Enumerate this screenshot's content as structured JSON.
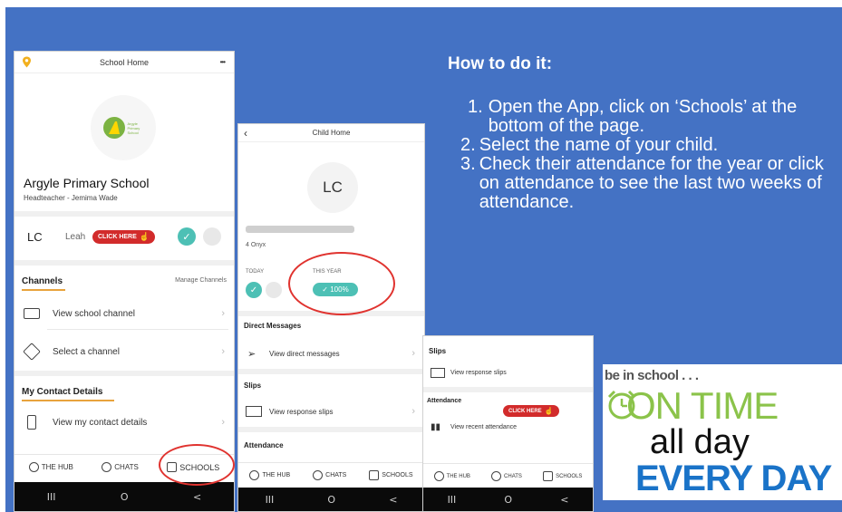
{
  "instructions": {
    "title": "How to do it:",
    "steps": [
      {
        "num": "1.",
        "text": "Open the App, click on ‘Schools’ at the bottom of the page."
      },
      {
        "num": "2.",
        "text": "Select the name of your child."
      },
      {
        "num": "3.",
        "text": "Check their attendance for the year or click on attendance to see the last two weeks of attendance."
      }
    ]
  },
  "phone1": {
    "header_title": "School Home",
    "more_label": "•••",
    "school_name": "Argyle Primary School",
    "headteacher": "Headteacher - Jemima Wade",
    "logo_text": "Argyle Primary School",
    "child_initials": "LC",
    "child_name_partial": "Leah",
    "click_here": "CLICK HERE",
    "channels_heading": "Channels",
    "manage_channels": "Manage Channels",
    "view_school_channel": "View school channel",
    "select_channel": "Select a channel",
    "contact_heading": "My Contact Details",
    "view_contact": "View my contact details",
    "tabs": {
      "hub": "THE HUB",
      "chats": "CHATS",
      "schools": "SCHOOLS"
    }
  },
  "phone2": {
    "back": "‹",
    "header_title": "Child Home",
    "initials": "LC",
    "class_label": "4 Onyx",
    "today_label": "TODAY",
    "this_year_label": "THIS YEAR",
    "this_year_value": "✓ 100%",
    "direct_messages_heading": "Direct Messages",
    "view_direct_messages": "View direct messages",
    "slips_heading": "Slips",
    "view_response_slips": "View response slips",
    "attendance_heading": "Attendance",
    "tabs": {
      "hub": "THE HUB",
      "chats": "CHATS",
      "schools": "SCHOOLS"
    }
  },
  "phone3": {
    "slips_heading": "Slips",
    "view_response_slips": "View response slips",
    "attendance_heading": "Attendance",
    "view_recent_attendance": "View recent attendance",
    "click_here": "CLICK HERE",
    "tabs": {
      "hub": "THE HUB",
      "chats": "CHATS",
      "schools": "SCHOOLS"
    }
  },
  "sysnav": {
    "recent": "III",
    "home": "O",
    "back": "<"
  },
  "badge": {
    "line1": "be in school . . .",
    "line2": "ON TIME",
    "line3": "all day",
    "line4": "EVERY DAY"
  },
  "colors": {
    "slide_blue": "#4472c4",
    "teal": "#4dc0b5",
    "red": "#e0332f",
    "green": "#8bc34a",
    "navy": "#1a73c8"
  }
}
